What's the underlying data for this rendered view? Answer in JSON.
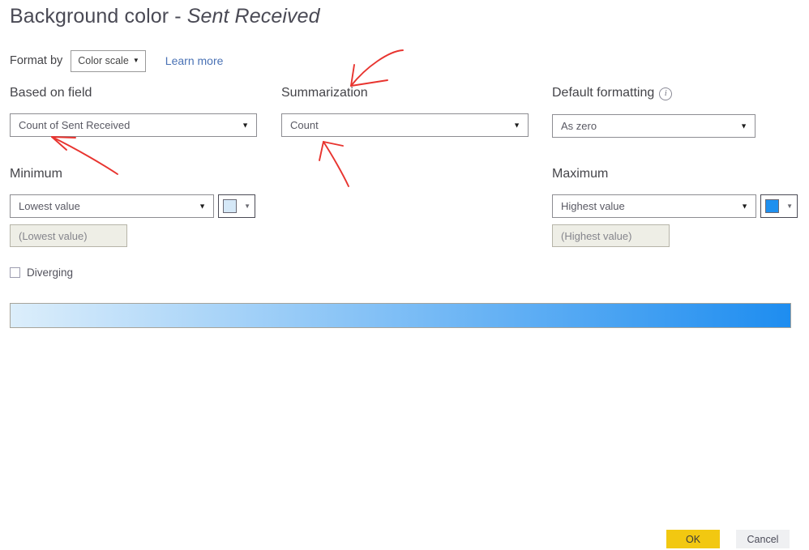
{
  "dialog": {
    "title_prefix": "Background color - ",
    "title_field": "Sent Received"
  },
  "format_by": {
    "label": "Format by",
    "value": "Color scale",
    "caret": "▼",
    "learn_more": "Learn more"
  },
  "based_on_field": {
    "label": "Based on field",
    "value": "Count of Sent Received",
    "caret": "▼"
  },
  "summarization": {
    "label": "Summarization",
    "value": "Count",
    "caret": "▼"
  },
  "default_formatting": {
    "label": "Default formatting",
    "info_icon": "i",
    "value": "As zero",
    "caret": "▼"
  },
  "minimum": {
    "label": "Minimum",
    "value": "Lowest value",
    "caret": "▼",
    "placeholder_value": "(Lowest value)",
    "color": "#d5e8f7",
    "picker_caret": "▼"
  },
  "maximum": {
    "label": "Maximum",
    "value": "Highest value",
    "caret": "▼",
    "placeholder_value": "(Highest value)",
    "color": "#1e90ef",
    "picker_caret": "▼"
  },
  "diverging": {
    "label": "Diverging",
    "checked": false
  },
  "gradient": {
    "start_color": "#dceefb",
    "end_color": "#1e8df0"
  },
  "footer": {
    "ok_label": "OK",
    "cancel_label": "Cancel",
    "ok_color": "#f2c811",
    "cancel_color": "#eff0f2"
  },
  "annotations": {
    "color": "#e8342f",
    "arrow_1_target": "Summarization label",
    "arrow_2_target": "Based on field dropdown",
    "arrow_3_target": "Summarization dropdown"
  }
}
